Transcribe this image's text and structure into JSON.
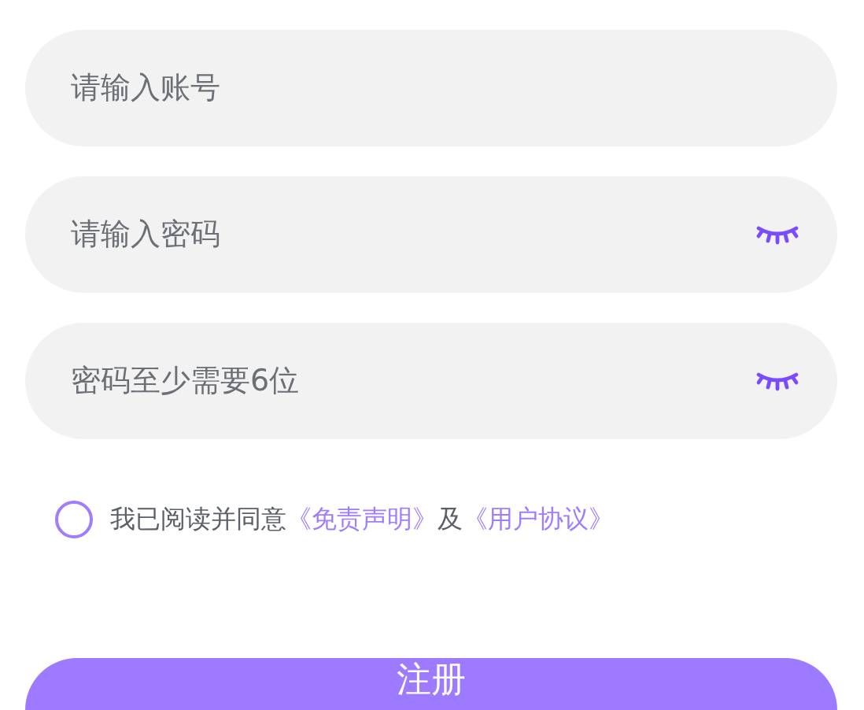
{
  "fields": [
    {
      "kind": "text",
      "placeholder": "请输入账号"
    },
    {
      "kind": "password",
      "placeholder": "请输入密码",
      "visible": false
    },
    {
      "kind": "password",
      "placeholder": "密码至少需要6位",
      "visible": false
    }
  ],
  "agreement": {
    "checked": false,
    "parts": [
      {
        "kind": "text",
        "text": "我已阅读并同意"
      },
      {
        "kind": "link",
        "text": "《免责声明》"
      },
      {
        "kind": "text",
        "text": "及"
      },
      {
        "kind": "link",
        "text": "《用户协议》"
      }
    ]
  },
  "submit": "注册"
}
